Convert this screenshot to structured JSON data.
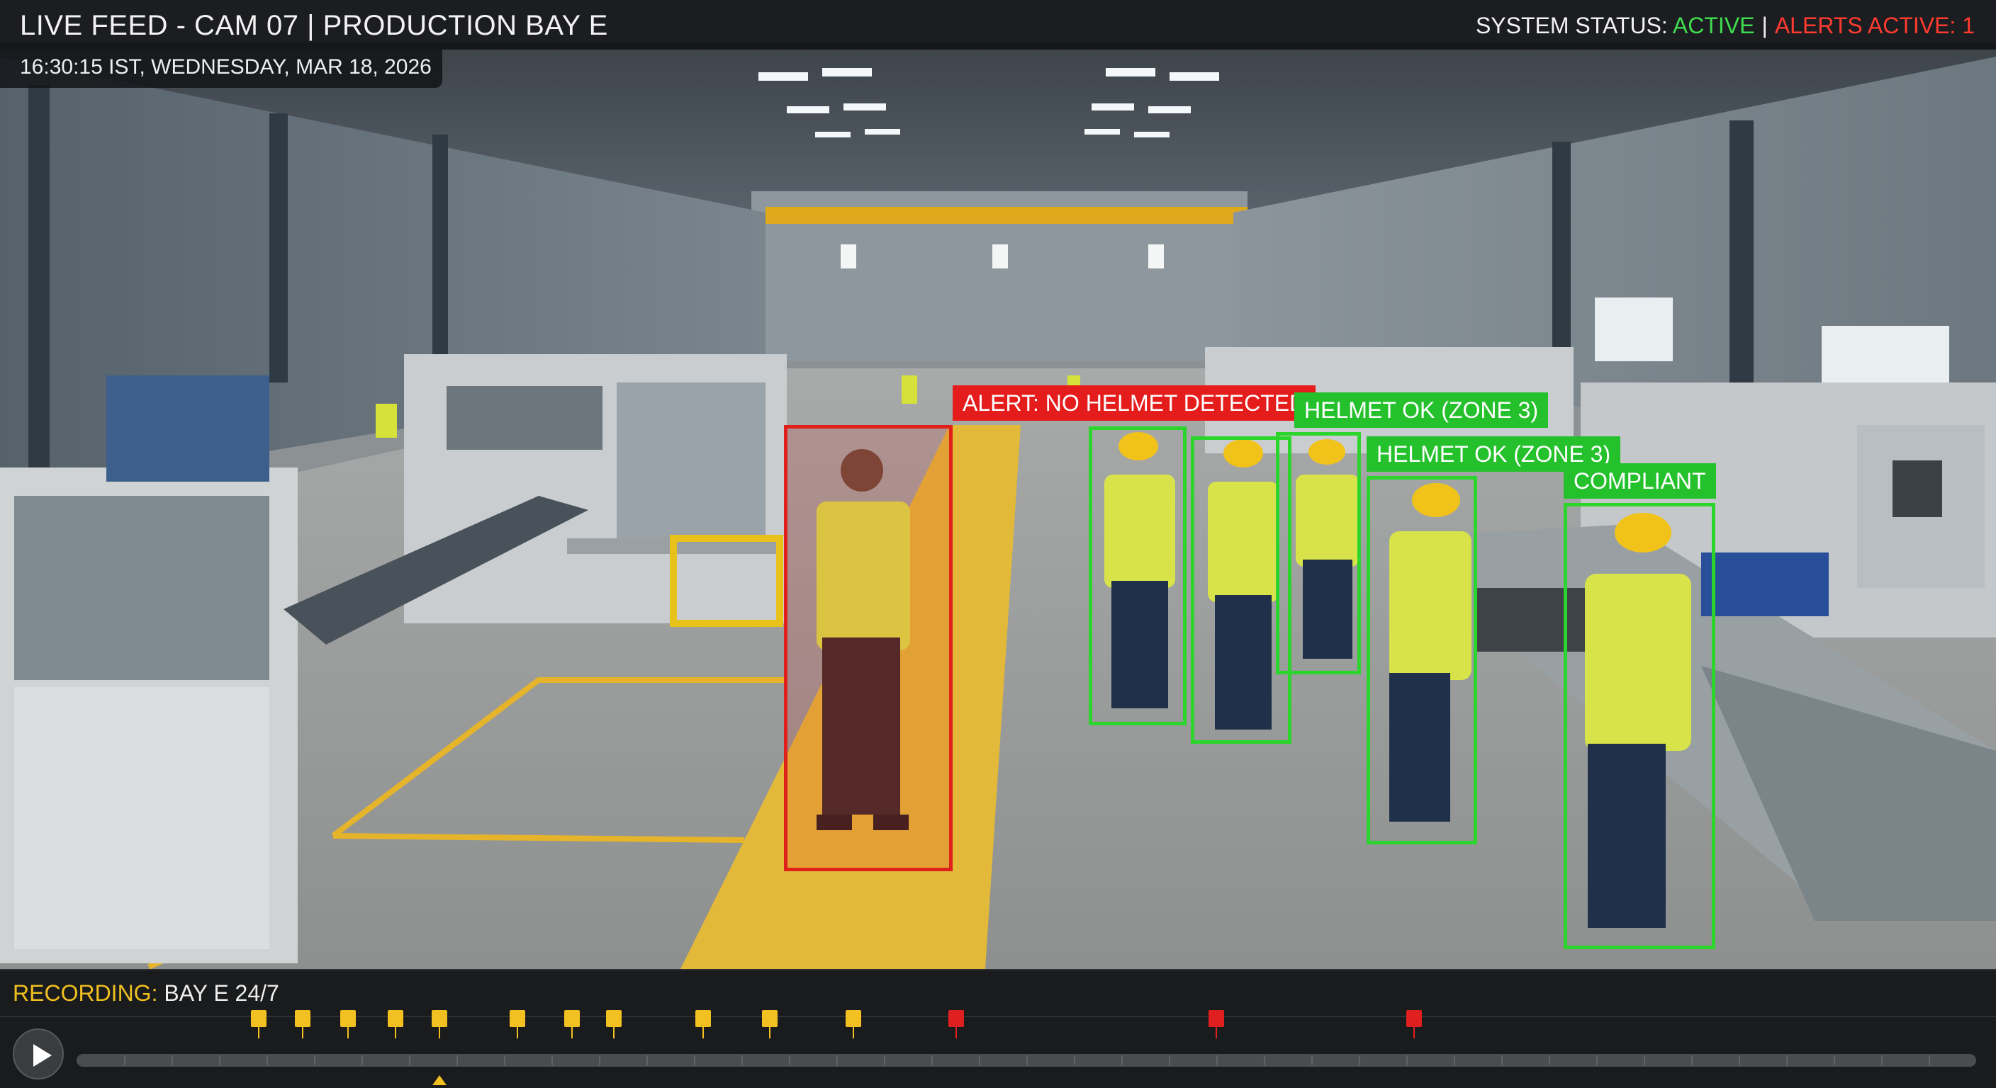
{
  "header": {
    "feed_title": "LIVE FEED - CAM 07 | PRODUCTION BAY E",
    "timestamp": "16:30:15 IST, WEDNESDAY, MAR 18, 2026",
    "status_label": "SYSTEM STATUS:",
    "status_value": "ACTIVE",
    "separator": "|",
    "alerts_text": "ALERTS ACTIVE: 1"
  },
  "detections": [
    {
      "label": "ALERT: NO HELMET DETECTED",
      "status": "alert"
    },
    {
      "label": "HELMET OK (ZONE 3)",
      "status": "ok"
    },
    {
      "label": "HELMET OK (ZONE 3)",
      "status": "ok"
    },
    {
      "label": "COMPLIANT",
      "status": "ok"
    }
  ],
  "footer": {
    "recording_key": "RECORDING:",
    "recording_value": "BAY E 24/7"
  },
  "timeline": {
    "yellow_markers": [
      0.096,
      0.119,
      0.143,
      0.168,
      0.191,
      0.232,
      0.261,
      0.283,
      0.33,
      0.365,
      0.409
    ],
    "red_markers": [
      0.463,
      0.6,
      0.704
    ],
    "playhead": 0.191
  },
  "colors": {
    "active": "#3fdc4f",
    "alert": "#ff3b30",
    "detection_ok": "#25c12c",
    "detection_alert": "#e51c1c",
    "marker_yellow": "#f2c020",
    "marker_red": "#e02020"
  },
  "icons": {
    "play": "play-icon"
  }
}
